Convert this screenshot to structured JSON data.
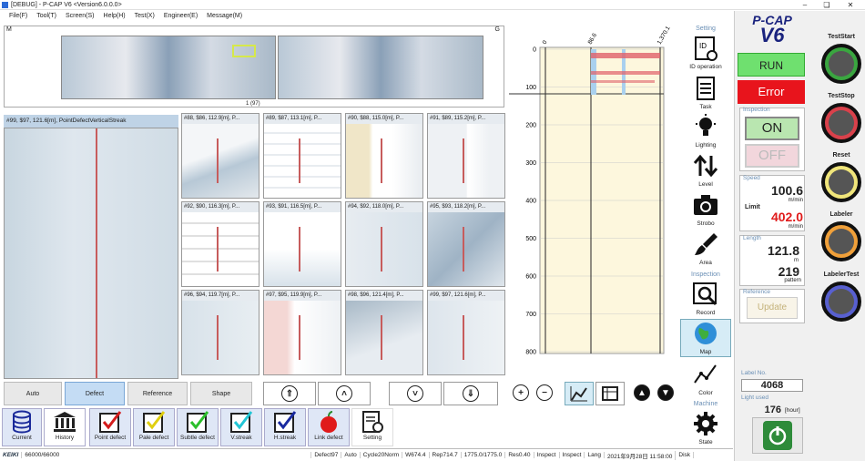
{
  "window": {
    "title": "[DEBUG] - P-CAP V6  <Version6.0.0.0>"
  },
  "menu": [
    "File(F)",
    "Tool(T)",
    "Screen(S)",
    "Help(H)",
    "Test(X)",
    "Engineer(E)",
    "Message(M)"
  ],
  "overview": {
    "left_tag": "M",
    "right_tag": "G",
    "counter": "1 (97)"
  },
  "main_image": {
    "header": "#99,  $97, 121.6[m], PointDefectVerticalStreak"
  },
  "thumbnails": [
    "#88,  $86, 112.9[m], P...",
    "#89,  $87, 113.1[m], P...",
    "#90,  $88, 115.0[m], P...",
    "#91,  $89, 115.2[m], P...",
    "#92,  $90, 116.3[m], P...",
    "#93,  $91, 116.5[m], P...",
    "#94,  $92, 118.0[m], P...",
    "#95,  $93, 118.2[m], P...",
    "#96,  $94, 119.7[m], P...",
    "#97,  $95, 119.9[m], P...",
    "#98,  $96, 121.4[m], P...",
    "#99,  $97, 121.6[m], P..."
  ],
  "view_tabs": [
    "Auto",
    "Defect",
    "Reference",
    "Shape"
  ],
  "toolbar": [
    "Current",
    "History",
    "Point defect",
    "Pale defect",
    "Subtle defect",
    "V.streak",
    "H.streak",
    "Link defect",
    "Setting"
  ],
  "status": {
    "logo": "KEIKI",
    "count": "66000/66000",
    "items": [
      "Defect97",
      "Auto",
      "Cycle20Norm",
      "W674.4",
      "Rep714.7",
      "1775.0/1775.0",
      "Res0.40",
      "Inspect",
      "Inspect",
      "Lang",
      "2021年9月28日 11:58:00",
      "Disk"
    ]
  },
  "map": {
    "x_ticks": [
      "0",
      "86.6",
      "1,370.1"
    ],
    "y_ticks": [
      "0",
      "100",
      "200",
      "300",
      "400",
      "500",
      "600",
      "700",
      "800"
    ]
  },
  "side_tools": {
    "setting_header": "Setting",
    "inspection_header": "Inspection",
    "machine_header": "Machine",
    "items": [
      "ID operation",
      "Task",
      "Lighting",
      "Level",
      "Strobo",
      "Area",
      "Record",
      "Map",
      "Color",
      "State"
    ]
  },
  "brand": {
    "line1": "P-CAP",
    "line2": "V6"
  },
  "run_status": {
    "run": "RUN",
    "error": "Error"
  },
  "inspection": {
    "header": "Inspection",
    "on": "ON",
    "off": "OFF"
  },
  "speed": {
    "header": "Speed",
    "value": "100.6",
    "unit": "m/min",
    "limit_label": "Limit",
    "limit_value": "402.0",
    "limit_unit": "m/min"
  },
  "length": {
    "header": "Length",
    "value": "121.8",
    "unit": "m",
    "pattern_value": "219",
    "pattern_unit": "pattern"
  },
  "reference": {
    "header": "Reference",
    "update": "Update"
  },
  "labels_panel": {
    "label_no_title": "Label No.",
    "label_no": "4068",
    "light_used_title": "Light used",
    "light_used": "176",
    "light_used_unit": "[hour]"
  },
  "lamps": [
    {
      "label": "TestStart",
      "color": "#3aa640"
    },
    {
      "label": "TestStop",
      "color": "#d9414b"
    },
    {
      "label": "Reset",
      "color": "#f0e57a"
    },
    {
      "label": "Labeler",
      "color": "#f0a03a"
    },
    {
      "label": "LabelerTest",
      "color": "#5860d0"
    }
  ],
  "colors": {
    "accent": "#6a8fb5",
    "run_green": "#6fe06f",
    "error_red": "#e8141c",
    "on_green": "#b9e6b0",
    "off_pink": "#f2d6dc"
  }
}
